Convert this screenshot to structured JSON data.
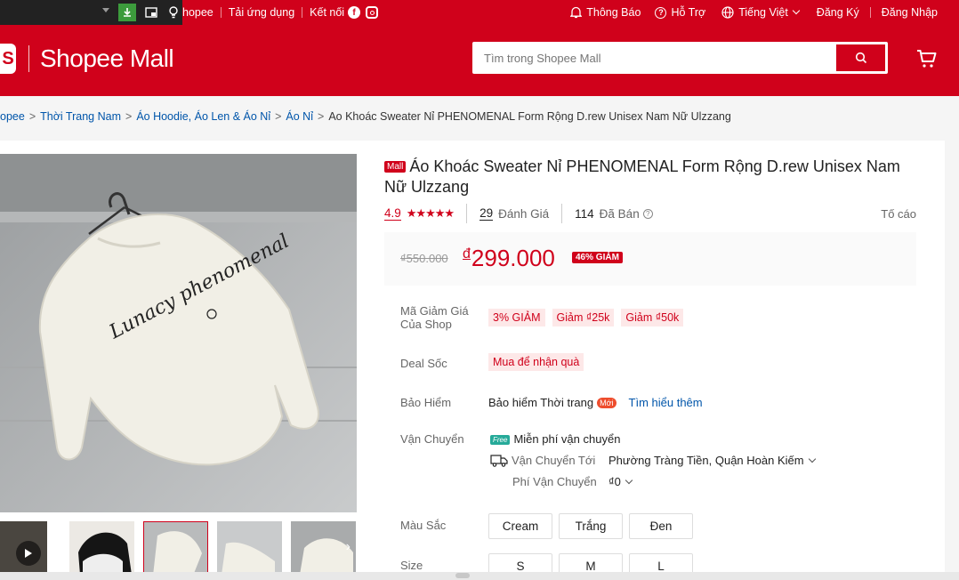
{
  "topbar": {
    "seller_link": "Kênh Người Bán | Trở thành Người bán Shopee",
    "seller_visible": "hopee",
    "app_link": "Tải ứng dụng",
    "connect_label": "Kết nối",
    "notifications": "Thông Báo",
    "help": "Hỗ Trợ",
    "language": "Tiếng Việt",
    "signup": "Đăng Ký",
    "login": "Đăng Nhập"
  },
  "header": {
    "logo_text": "Shopee Mall",
    "search_placeholder": "Tìm trong Shopee Mall"
  },
  "breadcrumb": {
    "items": [
      "opee",
      "Thời Trang Nam",
      "Áo Hoodie, Áo Len & Áo Nỉ",
      "Áo Nỉ"
    ],
    "current": "Ao Khoác Sweater Nỉ PHENOMENAL Form Rộng D.rew Unisex Nam Nữ Ulzzang"
  },
  "product": {
    "mall_badge": "Mall",
    "title": "Áo Khoác Sweater Nỉ PHENOMENAL Form Rộng D.rew Unisex Nam Nữ Ulzzang",
    "rating": "4.9",
    "stars": "★★★★★",
    "reviews_count": "29",
    "reviews_label": "Đánh Giá",
    "sold_count": "114",
    "sold_label": "Đã Bán",
    "report": "Tố cáo",
    "old_price": "₫550.000",
    "currency": "đ",
    "price": "299.000",
    "discount": "46% GIẢM",
    "shirt_text": "Lunacy phenomenal"
  },
  "details": {
    "voucher_label": "Mã Giảm Giá\nCủa Shop",
    "voucher_label_1": "Mã Giảm Giá",
    "voucher_label_2": "Của Shop",
    "vouchers": [
      "3% GIẢM",
      "Giảm ₫25k",
      "Giảm ₫50k"
    ],
    "deal_label": "Deal Sốc",
    "deal_value": "Mua để nhận quà",
    "insurance_label": "Bảo Hiểm",
    "insurance_value": "Bảo hiểm Thời trang",
    "insurance_badge": "Mới",
    "insurance_link": "Tìm hiểu thêm",
    "shipping_label": "Vận Chuyển",
    "free_ship_badge": "Free",
    "free_ship": "Miễn phí vận chuyển",
    "ship_to_label": "Vận Chuyển Tới",
    "ship_to_value": "Phường Tràng Tiền, Quận Hoàn Kiếm",
    "ship_fee_label": "Phí Vận Chuyển",
    "ship_fee_value": "₫0",
    "color_label": "Màu Sắc",
    "colors": [
      "Cream",
      "Trắng",
      "Đen"
    ],
    "size_label": "Size",
    "sizes": [
      "S",
      "M",
      "L"
    ]
  },
  "colors": {
    "brand": "#d0011b",
    "link": "#0055aa"
  }
}
